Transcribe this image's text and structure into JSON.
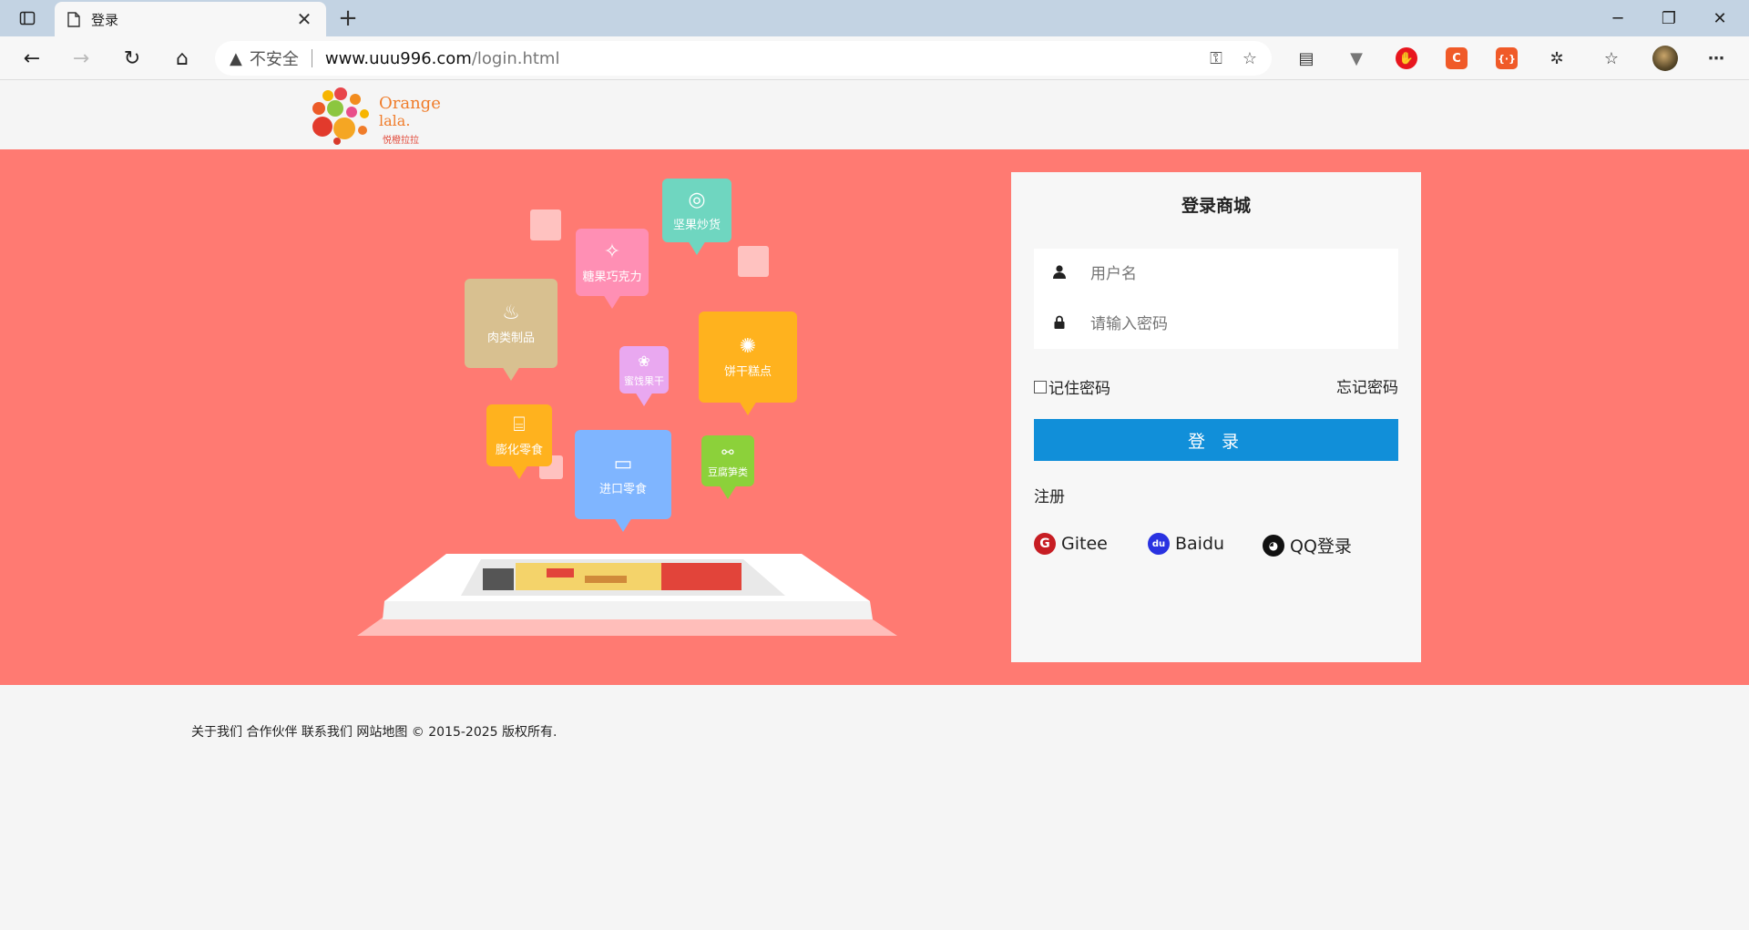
{
  "browser": {
    "tab_title": "登录",
    "url_warning": "不安全",
    "url_host": "www.uuu996.com",
    "url_path": "/login.html"
  },
  "logo": {
    "line1": "Orange",
    "line2": "lala.",
    "line3": "悦橙拉拉"
  },
  "illustration": {
    "categories": [
      {
        "label": "坚果炒货",
        "color": "#6fd6c0",
        "icon": "nut-icon"
      },
      {
        "label": "糖果巧克力",
        "color": "#ff8fb4",
        "icon": "candy-icon"
      },
      {
        "label": "肉类制品",
        "color": "#d8c090",
        "icon": "drumstick-icon"
      },
      {
        "label": "蜜饯果干",
        "color": "#e9a8f0",
        "icon": "fruit-icon"
      },
      {
        "label": "饼干糕点",
        "color": "#ffb21e",
        "icon": "cookie-icon"
      },
      {
        "label": "膨化零食",
        "color": "#ffb21e",
        "icon": "snack-icon"
      },
      {
        "label": "进口零食",
        "color": "#7fb5ff",
        "icon": "import-icon"
      },
      {
        "label": "豆腐笋类",
        "color": "#8cd13a",
        "icon": "tofu-icon"
      }
    ]
  },
  "login": {
    "title": "登录商城",
    "username_placeholder": "用户名",
    "password_placeholder": "请输入密码",
    "remember_label": "记住密码",
    "forgot_label": "忘记密码",
    "submit_label": "登 录",
    "register_label": "注册",
    "social": [
      {
        "label": "Gitee",
        "color": "#c71d23",
        "icon": "gitee-icon"
      },
      {
        "label": "Baidu",
        "color": "#2932e1",
        "icon": "baidu-icon"
      },
      {
        "label": "QQ登录",
        "color": "#111111",
        "icon": "qq-icon"
      }
    ]
  },
  "footer": {
    "text": "关于我们 合作伙伴 联系我们 网站地图 © 2015-2025 版权所有."
  },
  "colors": {
    "banner": "#ff7a72",
    "login_button": "#118fd9"
  }
}
